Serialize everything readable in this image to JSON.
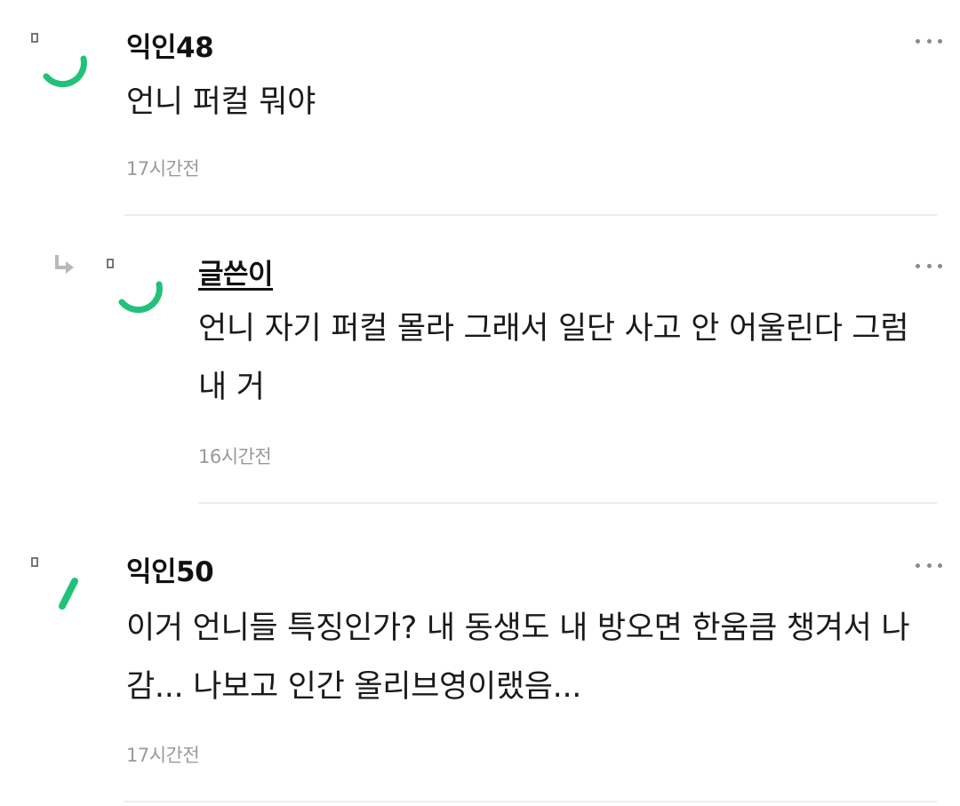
{
  "comments": [
    {
      "author": "익인48",
      "text": "언니 퍼컬 뭐야",
      "time": "17시간전"
    },
    {
      "author": "글쓴이",
      "text": "언니 자기 퍼컬 몰라 그래서 일단 사고 안 어울린다 그럼 내 거",
      "time": "16시간전",
      "is_reply": true
    },
    {
      "author": "익인50",
      "text": "이거 언니들 특징인가? 내 동생도 내 방오면 한움큼 챙겨서 나감... 나보고 인간 올리브영이랬음...",
      "time": "17시간전"
    }
  ],
  "icons": {
    "avatar": "avatar-loading-icon",
    "more": "more-dots-icon",
    "reply": "reply-arrow-icon"
  },
  "colors": {
    "accent": "#22c17a",
    "timestamp": "#9a9a9a",
    "divider": "#ececec"
  }
}
